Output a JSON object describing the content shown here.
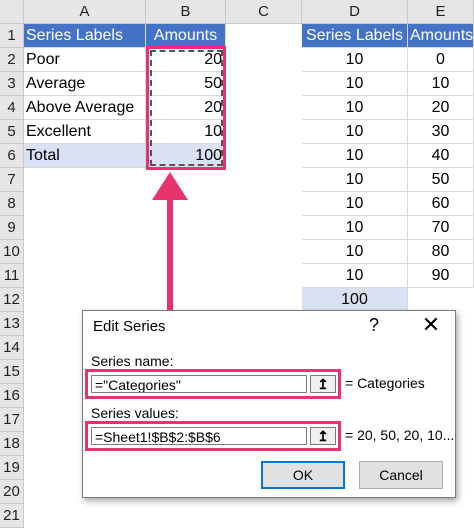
{
  "columns": [
    "A",
    "B",
    "C",
    "D",
    "E"
  ],
  "rows": [
    "1",
    "2",
    "3",
    "4",
    "5",
    "6",
    "7",
    "8",
    "9",
    "10",
    "11",
    "12",
    "13",
    "14",
    "15",
    "16",
    "17",
    "18",
    "19",
    "20",
    "21"
  ],
  "sheet": {
    "A": [
      "Series Labels",
      "Poor",
      "Average",
      "Above Average",
      "Excellent",
      "Total"
    ],
    "B": [
      "Amounts",
      "20",
      "50",
      "20",
      "10",
      "100"
    ],
    "D": [
      "Series Labels",
      "10",
      "10",
      "10",
      "10",
      "10",
      "10",
      "10",
      "10",
      "10",
      "10",
      "100"
    ],
    "E": [
      "Amounts",
      "0",
      "10",
      "20",
      "30",
      "40",
      "50",
      "60",
      "70",
      "80",
      "90"
    ]
  },
  "dialog": {
    "title": "Edit Series",
    "help": "?",
    "close": "✕",
    "series_name_label": "Series name:",
    "series_name_value": "=\"Categories\"",
    "series_name_preview": "= Categories",
    "series_values_label": "Series values:",
    "series_values_value": "=Sheet1!$B$2:$B$6",
    "series_values_preview": "= 20, 50, 20, 10...",
    "collapse_icon": "↥",
    "ok_label": "OK",
    "cancel_label": "Cancel"
  },
  "colors": {
    "header_fill": "#4472c4",
    "total_fill": "#d9e1f2",
    "highlight": "#e8336d"
  }
}
